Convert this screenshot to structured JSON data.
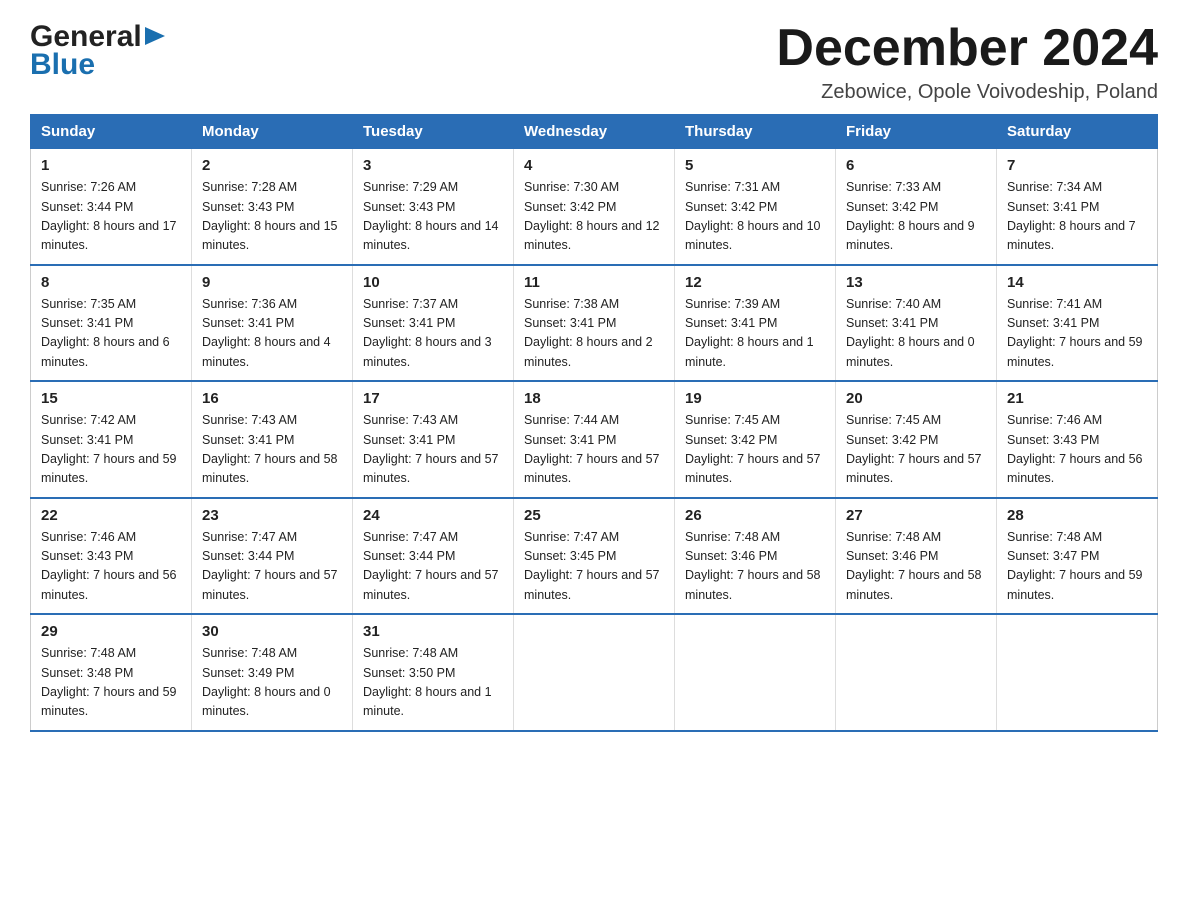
{
  "header": {
    "logo_general": "General",
    "logo_blue": "Blue",
    "month_year": "December 2024",
    "location": "Zebowice, Opole Voivodeship, Poland"
  },
  "days_of_week": [
    "Sunday",
    "Monday",
    "Tuesday",
    "Wednesday",
    "Thursday",
    "Friday",
    "Saturday"
  ],
  "weeks": [
    [
      {
        "day": "1",
        "sunrise": "7:26 AM",
        "sunset": "3:44 PM",
        "daylight": "8 hours and 17 minutes."
      },
      {
        "day": "2",
        "sunrise": "7:28 AM",
        "sunset": "3:43 PM",
        "daylight": "8 hours and 15 minutes."
      },
      {
        "day": "3",
        "sunrise": "7:29 AM",
        "sunset": "3:43 PM",
        "daylight": "8 hours and 14 minutes."
      },
      {
        "day": "4",
        "sunrise": "7:30 AM",
        "sunset": "3:42 PM",
        "daylight": "8 hours and 12 minutes."
      },
      {
        "day": "5",
        "sunrise": "7:31 AM",
        "sunset": "3:42 PM",
        "daylight": "8 hours and 10 minutes."
      },
      {
        "day": "6",
        "sunrise": "7:33 AM",
        "sunset": "3:42 PM",
        "daylight": "8 hours and 9 minutes."
      },
      {
        "day": "7",
        "sunrise": "7:34 AM",
        "sunset": "3:41 PM",
        "daylight": "8 hours and 7 minutes."
      }
    ],
    [
      {
        "day": "8",
        "sunrise": "7:35 AM",
        "sunset": "3:41 PM",
        "daylight": "8 hours and 6 minutes."
      },
      {
        "day": "9",
        "sunrise": "7:36 AM",
        "sunset": "3:41 PM",
        "daylight": "8 hours and 4 minutes."
      },
      {
        "day": "10",
        "sunrise": "7:37 AM",
        "sunset": "3:41 PM",
        "daylight": "8 hours and 3 minutes."
      },
      {
        "day": "11",
        "sunrise": "7:38 AM",
        "sunset": "3:41 PM",
        "daylight": "8 hours and 2 minutes."
      },
      {
        "day": "12",
        "sunrise": "7:39 AM",
        "sunset": "3:41 PM",
        "daylight": "8 hours and 1 minute."
      },
      {
        "day": "13",
        "sunrise": "7:40 AM",
        "sunset": "3:41 PM",
        "daylight": "8 hours and 0 minutes."
      },
      {
        "day": "14",
        "sunrise": "7:41 AM",
        "sunset": "3:41 PM",
        "daylight": "7 hours and 59 minutes."
      }
    ],
    [
      {
        "day": "15",
        "sunrise": "7:42 AM",
        "sunset": "3:41 PM",
        "daylight": "7 hours and 59 minutes."
      },
      {
        "day": "16",
        "sunrise": "7:43 AM",
        "sunset": "3:41 PM",
        "daylight": "7 hours and 58 minutes."
      },
      {
        "day": "17",
        "sunrise": "7:43 AM",
        "sunset": "3:41 PM",
        "daylight": "7 hours and 57 minutes."
      },
      {
        "day": "18",
        "sunrise": "7:44 AM",
        "sunset": "3:41 PM",
        "daylight": "7 hours and 57 minutes."
      },
      {
        "day": "19",
        "sunrise": "7:45 AM",
        "sunset": "3:42 PM",
        "daylight": "7 hours and 57 minutes."
      },
      {
        "day": "20",
        "sunrise": "7:45 AM",
        "sunset": "3:42 PM",
        "daylight": "7 hours and 57 minutes."
      },
      {
        "day": "21",
        "sunrise": "7:46 AM",
        "sunset": "3:43 PM",
        "daylight": "7 hours and 56 minutes."
      }
    ],
    [
      {
        "day": "22",
        "sunrise": "7:46 AM",
        "sunset": "3:43 PM",
        "daylight": "7 hours and 56 minutes."
      },
      {
        "day": "23",
        "sunrise": "7:47 AM",
        "sunset": "3:44 PM",
        "daylight": "7 hours and 57 minutes."
      },
      {
        "day": "24",
        "sunrise": "7:47 AM",
        "sunset": "3:44 PM",
        "daylight": "7 hours and 57 minutes."
      },
      {
        "day": "25",
        "sunrise": "7:47 AM",
        "sunset": "3:45 PM",
        "daylight": "7 hours and 57 minutes."
      },
      {
        "day": "26",
        "sunrise": "7:48 AM",
        "sunset": "3:46 PM",
        "daylight": "7 hours and 58 minutes."
      },
      {
        "day": "27",
        "sunrise": "7:48 AM",
        "sunset": "3:46 PM",
        "daylight": "7 hours and 58 minutes."
      },
      {
        "day": "28",
        "sunrise": "7:48 AM",
        "sunset": "3:47 PM",
        "daylight": "7 hours and 59 minutes."
      }
    ],
    [
      {
        "day": "29",
        "sunrise": "7:48 AM",
        "sunset": "3:48 PM",
        "daylight": "7 hours and 59 minutes."
      },
      {
        "day": "30",
        "sunrise": "7:48 AM",
        "sunset": "3:49 PM",
        "daylight": "8 hours and 0 minutes."
      },
      {
        "day": "31",
        "sunrise": "7:48 AM",
        "sunset": "3:50 PM",
        "daylight": "8 hours and 1 minute."
      },
      null,
      null,
      null,
      null
    ]
  ],
  "labels": {
    "sunrise": "Sunrise:",
    "sunset": "Sunset:",
    "daylight": "Daylight:"
  }
}
